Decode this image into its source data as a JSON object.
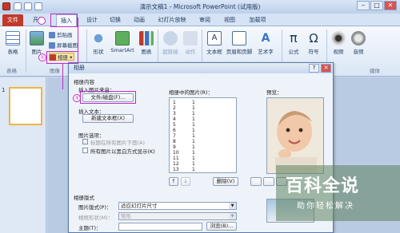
{
  "window": {
    "title": "演示文稿1 - Microsoft PowerPoint (试用版)",
    "controls": [
      "–",
      "□",
      "✕"
    ]
  },
  "tabs": [
    {
      "label": "文件",
      "kind": "file"
    },
    {
      "label": "开始",
      "kind": "normal"
    },
    {
      "label": "插入",
      "kind": "active"
    },
    {
      "label": "设计",
      "kind": "normal"
    },
    {
      "label": "切换",
      "kind": "normal"
    },
    {
      "label": "动画",
      "kind": "normal"
    },
    {
      "label": "幻灯片放映",
      "kind": "normal"
    },
    {
      "label": "审阅",
      "kind": "normal"
    },
    {
      "label": "视图",
      "kind": "normal"
    },
    {
      "label": "加载项",
      "kind": "normal"
    }
  ],
  "ribbon": {
    "table": "表格",
    "picture": "图片",
    "clipart": "剪贴画",
    "screenshot": "屏幕截图",
    "album": "相册",
    "shapes": "形状",
    "smartart": "SmartArt",
    "chart": "图表",
    "hyperlink": "超链接",
    "action": "动作",
    "textbox": "文本框",
    "headerfooter": "页眉和页脚",
    "wordart": "艺术字",
    "formula": "公式",
    "symbol": "符号",
    "video": "视频",
    "audio": "音频",
    "group_tables": "表格",
    "group_images": "图像",
    "group_media": "媒体"
  },
  "slides": {
    "number": "1"
  },
  "dialog": {
    "title": "相册",
    "help": "?",
    "close": "✕",
    "album_content": "相册内容",
    "insert_from": "插入图片来自：",
    "file_disk_button": "文件/磁盘(F)...",
    "insert_text": "插入文本：",
    "new_textbox_button": "新建文本框(X)",
    "picture_options": "图片选项：",
    "option_caption": "标题在所有图片下面(A)",
    "option_bw": "所有图片以黑白方式显示(K)",
    "pictures_in_album": "相册中的图片(R)：",
    "list_rows": [
      {
        "num": "1",
        "val": "1"
      },
      {
        "num": "2",
        "val": "1"
      },
      {
        "num": "3",
        "val": "1"
      },
      {
        "num": "4",
        "val": "1"
      },
      {
        "num": "5",
        "val": "1"
      },
      {
        "num": "6",
        "val": "1"
      },
      {
        "num": "7",
        "val": "1"
      },
      {
        "num": "8",
        "val": "1"
      },
      {
        "num": "9",
        "val": "1"
      },
      {
        "num": "10",
        "val": "1"
      },
      {
        "num": "11",
        "val": "1"
      },
      {
        "num": "12",
        "val": "1"
      },
      {
        "num": "13",
        "val": "1"
      }
    ],
    "move_up": "↑",
    "move_down": "↓",
    "delete_button": "删除(V)",
    "preview": "预览：",
    "layout_section": "相册版式",
    "picture_layout_label": "图片版式(P)：",
    "picture_layout_value": "适应幻灯片尺寸",
    "frame_shape_label": "相框形状(M)：",
    "frame_shape_value": "矩形",
    "theme_label": "主题(T)：",
    "browse_button": "浏览(B)..."
  },
  "callouts": {
    "step2": "②",
    "step3": "③"
  },
  "watermark": {
    "main": "百科全说",
    "sub": "助你轻松解决"
  }
}
